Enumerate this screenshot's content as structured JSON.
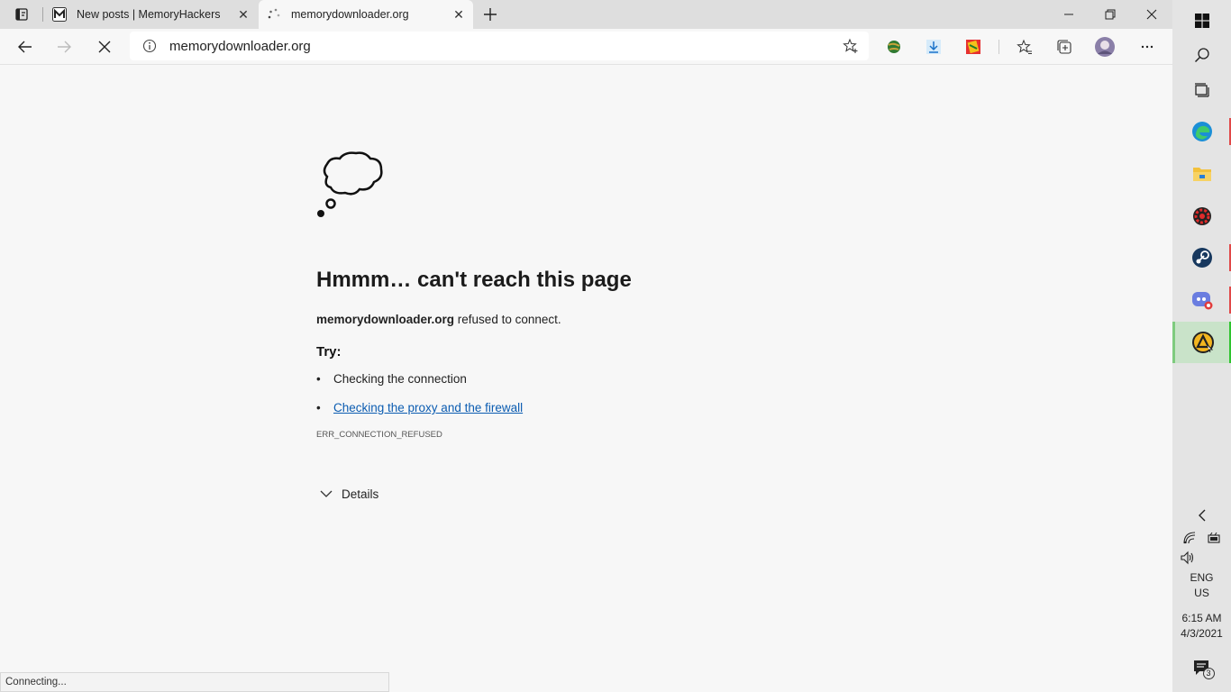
{
  "tabs": [
    {
      "title": "New posts | MemoryHackers",
      "favicon": "memoryhackers-m-icon",
      "close": "✕"
    },
    {
      "title": "memorydownloader.org",
      "favicon": "loading-spinner-icon",
      "close": "✕"
    }
  ],
  "address": {
    "url": "memorydownloader.org"
  },
  "error": {
    "heading": "Hmmm… can't reach this page",
    "host": "memorydownloader.org",
    "message": "refused to connect.",
    "try_label": "Try:",
    "tips": [
      "Checking the connection",
      "Checking the proxy and the firewall"
    ],
    "code": "ERR_CONNECTION_REFUSED",
    "details": "Details"
  },
  "status": "Connecting...",
  "tray": {
    "lang1": "ENG",
    "lang2": "US",
    "time": "6:15 AM",
    "date": "4/3/2021",
    "notifications": "3"
  },
  "colors": {
    "link": "#0b5cb1",
    "running_indicator": "#e04848",
    "active_indicator": "#2ec42e"
  }
}
